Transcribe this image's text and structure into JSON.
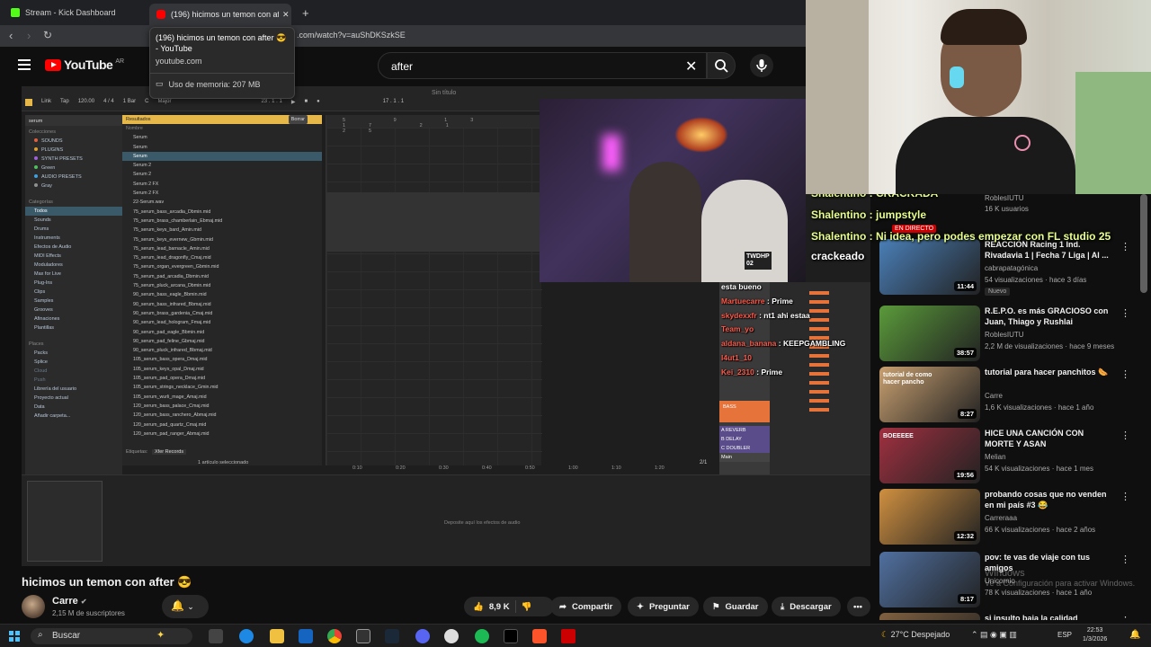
{
  "browser": {
    "tabs": [
      {
        "title": "Stream - Kick Dashboard",
        "favicon_color": "#53fc18"
      },
      {
        "title": "(196) hicimos un temon con afte",
        "favicon_color": "#ff0000"
      }
    ],
    "new_tab_label": "+",
    "url": ".com/watch?v=auShDKSzkSE",
    "tooltip": {
      "title": "(196) hicimos un temon con after 😎 - YouTube",
      "domain": "youtube.com",
      "memory": "Uso de memoria: 207 MB"
    }
  },
  "youtube": {
    "logo": "YouTube",
    "country": "AR",
    "search_value": "after",
    "video_title": "hicimos un temon con after 😎",
    "channel": "Carre",
    "subscribers": "2,15 M de suscriptores",
    "actions": {
      "likes": "8,9 K",
      "share": "Compartir",
      "ask": "Preguntar",
      "save": "Guardar",
      "download": "Descargar"
    }
  },
  "daw": {
    "window_title": "Sin título",
    "toolbar": [
      "Link",
      "Tap",
      "120.00",
      "4 / 4",
      "1 Bar",
      "C",
      "Major"
    ],
    "position": "23 . 1 . 1",
    "loop_end": "17 . 1 . 1",
    "search": "serum",
    "collections_header": "Colecciones",
    "collections": [
      "SOUNDS",
      "PLUGINS",
      "SYNTH PRESETS",
      "Green",
      "AUDIO PRESETS",
      "Gray"
    ],
    "categories_header": "Categorías",
    "categories": [
      "Todos",
      "Sounds",
      "Drums",
      "Instruments",
      "Efectos de Audio",
      "MIDI Effects",
      "Moduladores",
      "Max for Live",
      "Plug-Ins",
      "Clips",
      "Samples",
      "Grooves",
      "Afinaciones",
      "Plantillas"
    ],
    "places_header": "Places",
    "places": [
      "Packs",
      "Splice",
      "Cloud",
      "Push",
      "Librería del usuario",
      "Proyecto actual",
      "Data",
      "Añadir carpeta..."
    ],
    "results_header": "Resultados",
    "results_clear": "Borrar",
    "results_column": "Nombre",
    "results": [
      "Serum",
      "Serum",
      "Serum",
      "Serum 2",
      "Serum 2",
      "Serum 2 FX",
      "Serum 2 FX",
      "22-Serum.wav",
      "75_serum_bass_arcadia_Dbmin.mid",
      "75_serum_brass_chamberlain_Ebmaj.mid",
      "75_serum_keys_bard_Amin.mid",
      "75_serum_keys_evernew_Gbmin.mid",
      "75_serum_lead_barnacle_Amin.mid",
      "75_serum_lead_dragonfly_Cmaj.mid",
      "75_serum_organ_evergreen_Gbmin.mid",
      "75_serum_pad_arcadia_Dbmin.mid",
      "75_serum_pluck_arcana_Dbmin.mid",
      "90_serum_bass_eagle_Bbmin.mid",
      "90_serum_bass_infrared_Bbmaj.mid",
      "90_serum_brass_gardenia_Cmaj.mid",
      "90_serum_lead_hologram_Fmaj.mid",
      "90_serum_pad_eagle_Bbmin.mid",
      "90_serum_pad_feline_Gbmaj.mid",
      "90_serum_pluck_infrared_Bbmaj.mid",
      "105_serum_bass_opera_Dmaj.mid",
      "105_serum_keys_opal_Dmaj.mid",
      "105_serum_pad_opera_Dmaj.mid",
      "105_serum_strings_necklace_Gmin.mid",
      "105_serum_wurli_mage_Amaj.mid",
      "120_serum_bass_palace_Cmaj.mid",
      "120_serum_bass_ranchero_Abmaj.mid",
      "120_serum_pad_quartz_Cmaj.mid",
      "120_serum_pad_ranger_Abmaj.mid"
    ],
    "tags_label": "Etiquetas:",
    "tag": "Xfer Records",
    "status": "1 artículo seleccionado",
    "timeline": [
      "0:10",
      "0:20",
      "0:30",
      "0:40",
      "0:50",
      "1:00",
      "1:10",
      "1:20"
    ],
    "drop_hint": "Deposite aquí los efectos de audio",
    "track_labels": [
      "BASS",
      "A REVERB",
      "B DELAY",
      "C DOUBLER",
      "Main"
    ],
    "page_indicator": "2/1"
  },
  "stream_chat": [
    {
      "user": "esta bueno",
      "msg": "",
      "color": "#ffffff"
    },
    {
      "user": "Martuecarre",
      "msg": "Prime",
      "color": "#ff5a4a"
    },
    {
      "user": "skydexxfr",
      "msg": "nt1 ahi estaa",
      "color": "#ff5a4a"
    },
    {
      "user": "Team_yo",
      "msg": "",
      "color": "#ff5a4a"
    },
    {
      "user": "aldana_banana",
      "msg": "KEEPGAMBLING",
      "color": "#ff5a4a"
    },
    {
      "user": "l4ut1_10",
      "msg": "",
      "color": "#ff5a4a"
    },
    {
      "user": "Kei_2310",
      "msg": "Prime",
      "color": "#ff5a4a"
    }
  ],
  "overlay": {
    "line0": "Shalentino : CRACKADA",
    "line1": "Shalentino : jumpstyle",
    "line2": "Shalentino : Ni idea, pero podes empezar con FL studio 25",
    "line3": "crackeado",
    "live_badge": "EN DIRECTO"
  },
  "sidebar": {
    "top_meta": [
      "RoblesIUTU",
      "16 K usuarios"
    ],
    "videos": [
      {
        "title": "REACCIÓN Racing 1 Ind. Rivadavia 1 | Fecha 7 Liga | Al ...",
        "channel": "cabrapatagónica",
        "meta": "54 visualizaciones · hace 3 días",
        "duration": "11:44",
        "badge": "Nuevo"
      },
      {
        "title": "R.E.P.O. es más GRACIOSO con Juan, Thiago y Rushlai",
        "channel": "RoblesIUTU",
        "meta": "2,2 M de visualizaciones · hace 9 meses",
        "duration": "38:57",
        "badge": ""
      },
      {
        "title": "tutorial para hacer panchitos 🌭",
        "channel": "Carre",
        "meta": "1,6 K visualizaciones · hace 1 año",
        "duration": "8:27",
        "badge": ""
      },
      {
        "title": "HICE UNA CANCIÓN CON MORTE Y ASAN",
        "channel": "Melian",
        "meta": "54 K visualizaciones · hace 1 mes",
        "duration": "19:56",
        "badge": ""
      },
      {
        "title": "probando cosas que no venden en mi país #3 😂",
        "channel": "Carreraaa",
        "meta": "66 K visualizaciones · hace 2 años",
        "duration": "12:32",
        "badge": ""
      },
      {
        "title": "pov: te vas de viaje con tus amigos",
        "channel": "Unicornio",
        "meta": "78 K visualizaciones · hace 1 año",
        "duration": "8:17",
        "badge": ""
      },
      {
        "title": "si insulto baja la calidad",
        "channel": "",
        "meta": "",
        "duration": "",
        "badge": ""
      }
    ],
    "thumb_colors": [
      "#4a7fb8",
      "#5a9a3a",
      "#c8a070",
      "#a03040",
      "#d09040",
      "#5070a0",
      "#806040"
    ],
    "thumb_texts": [
      "",
      "",
      "tutorial de como hacer pancho",
      "BOEEEEE",
      "",
      "",
      ""
    ]
  },
  "windows": {
    "search_placeholder": "Buscar",
    "weather": "27°C  Despejado",
    "lang": "ESP",
    "time": "22:53",
    "date": "1/3/2026",
    "activate_title": "Windows",
    "activate_text": "Ve a Configuración para activar Windows."
  }
}
